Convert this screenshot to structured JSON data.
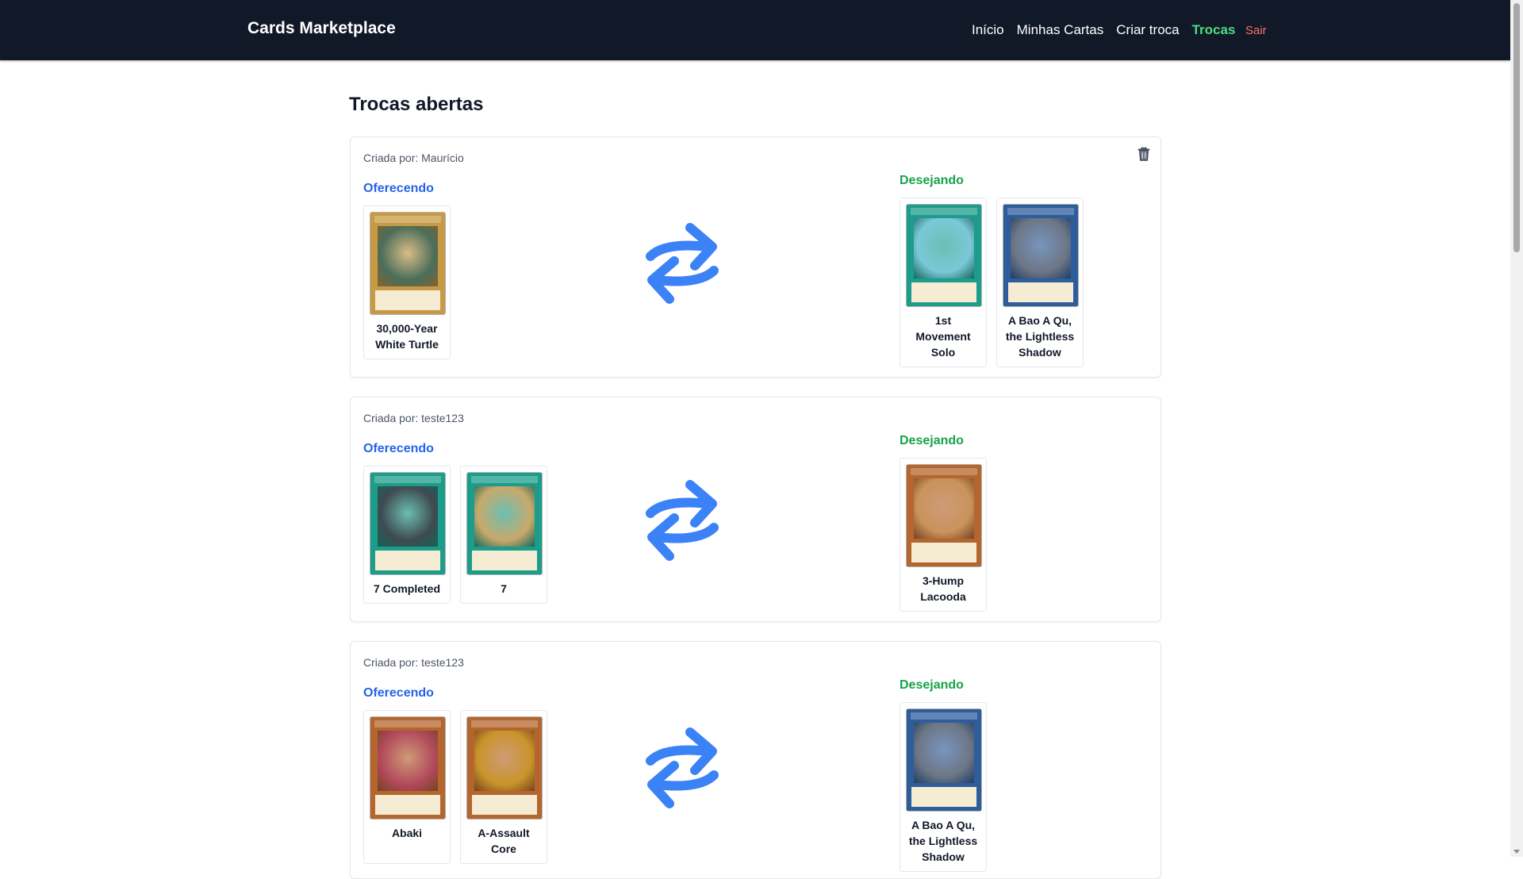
{
  "app": {
    "brand": "Cards Marketplace"
  },
  "nav": {
    "links": [
      "Início",
      "Minhas Cartas",
      "Criar troca",
      "Trocas"
    ],
    "active": "Trocas",
    "logout": "Sair"
  },
  "page": {
    "title": "Trocas abertas"
  },
  "labels": {
    "offer": "Oferecendo",
    "want": "Desejando"
  },
  "trades": [
    {
      "creator": "Criada por: Maurício",
      "offering": [
        {
          "name": "30,000-Year White Turtle",
          "frame": "#c79a45",
          "art": "#4b6d5a"
        }
      ],
      "wanting": [
        {
          "name": "1st Movement Solo",
          "frame": "#1c9c8a",
          "art": "#7ac8d9"
        },
        {
          "name": "A Bao A Qu, the Lightless Shadow",
          "frame": "#2e5d9c",
          "art": "#6d7685"
        }
      ]
    },
    {
      "creator": "Criada por: teste123",
      "offering": [
        {
          "name": "7 Completed",
          "frame": "#1c9c8a",
          "art": "#3f4a4f"
        },
        {
          "name": "7",
          "frame": "#1c9c8a",
          "art": "#c9a96a"
        }
      ],
      "wanting": [
        {
          "name": "3-Hump Lacooda",
          "frame": "#b5652e",
          "art": "#c9935c"
        }
      ]
    },
    {
      "creator": "Criada por: teste123",
      "offering": [
        {
          "name": "Abaki",
          "frame": "#b5652e",
          "art": "#b24a5c"
        },
        {
          "name": "A-Assault Core",
          "frame": "#b5652e",
          "art": "#c9942a"
        }
      ],
      "wanting": [
        {
          "name": "A Bao A Qu, the Lightless Shadow",
          "frame": "#2e5d9c",
          "art": "#6d7685"
        }
      ]
    }
  ],
  "colors": {
    "navbar": "#111827",
    "active_link": "#4ade80",
    "logout": "#f87171",
    "offer": "#2563eb",
    "want": "#16a34a",
    "swap_icon": "#3b82f6"
  },
  "icons": {
    "delete": "trash-icon",
    "swap": "swap-arrows-icon"
  }
}
